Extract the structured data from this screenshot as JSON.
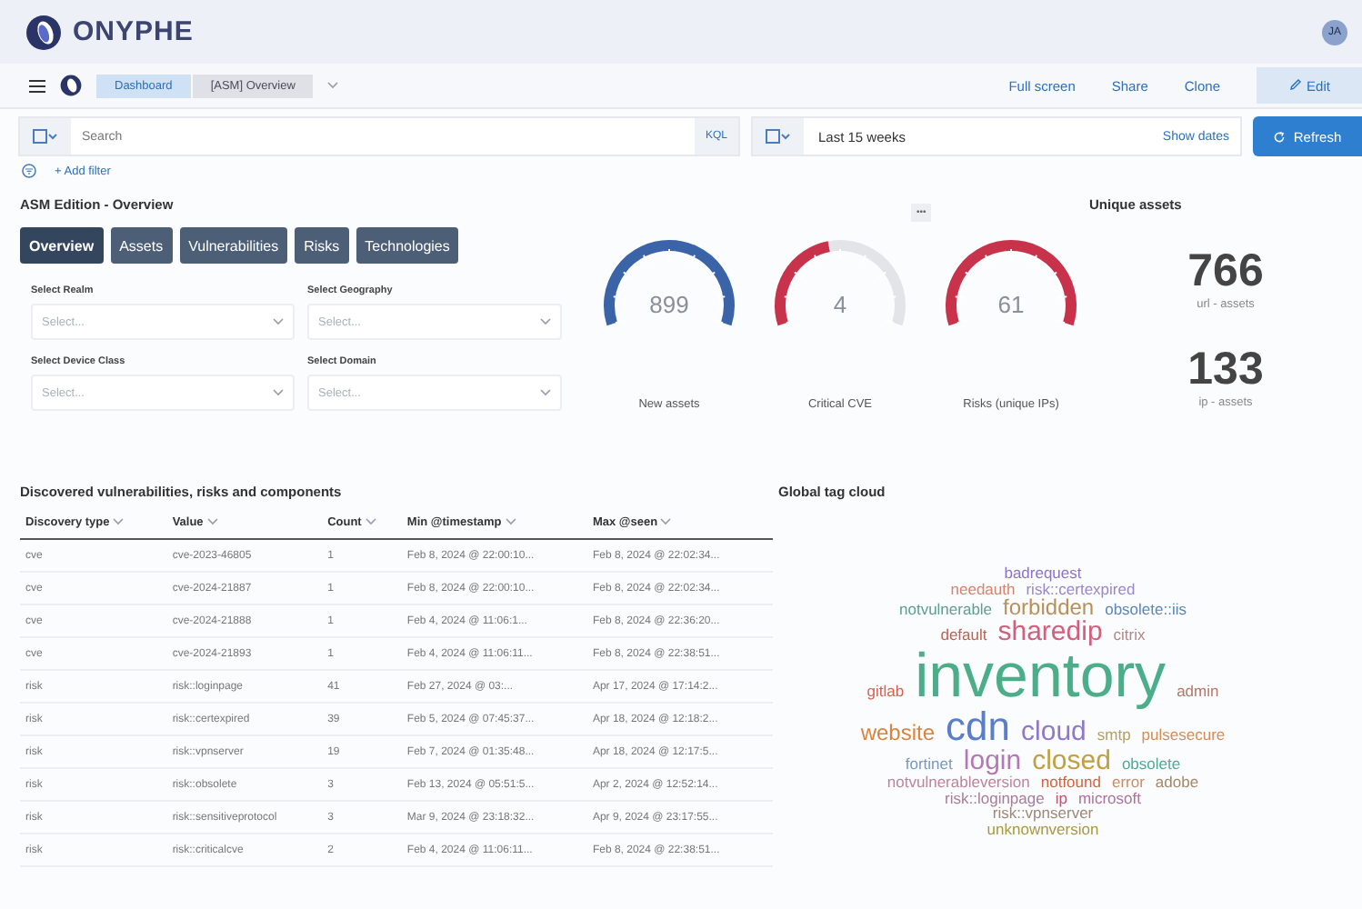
{
  "header": {
    "brand": "ONYPHE",
    "avatar": "JA"
  },
  "nav": {
    "breadcrumbs": [
      {
        "label": "Dashboard",
        "selected": false
      },
      {
        "label": "[ASM] Overview",
        "selected": true
      }
    ],
    "links": [
      "Full screen",
      "Share",
      "Clone"
    ],
    "edit": "Edit"
  },
  "query": {
    "placeholder": "Search",
    "language": "KQL",
    "time_range": "Last 15 weeks",
    "show_dates": "Show dates",
    "refresh": "Refresh",
    "add_filter": "+ Add filter"
  },
  "overview": {
    "title": "ASM Edition - Overview",
    "tabs": [
      {
        "label": "Overview",
        "selected": true
      },
      {
        "label": "Assets",
        "selected": false
      },
      {
        "label": "Vulnerabilities",
        "selected": false
      },
      {
        "label": "Risks",
        "selected": false
      },
      {
        "label": "Technologies",
        "selected": false
      }
    ],
    "selects": [
      {
        "label": "Select Realm",
        "placeholder": "Select..."
      },
      {
        "label": "Select Geography",
        "placeholder": "Select..."
      },
      {
        "label": "Select Device Class",
        "placeholder": "Select..."
      },
      {
        "label": "Select Domain",
        "placeholder": "Select..."
      }
    ]
  },
  "gauges": [
    {
      "value": "899",
      "label": "New assets",
      "level": 1,
      "color": "#3b64a8"
    },
    {
      "value": "4",
      "label": "Critical CVE",
      "level": 0.45,
      "color": "#c8324b"
    },
    {
      "value": "61",
      "label": "Risks (unique IPs)",
      "level": 1,
      "color": "#c8324b"
    }
  ],
  "more": "•••",
  "unique_assets": {
    "title": "Unique assets",
    "metrics": [
      {
        "value": "766",
        "label": "url - assets"
      },
      {
        "value": "133",
        "label": "ip - assets"
      }
    ]
  },
  "table": {
    "title": "Discovered vulnerabilities, risks and components",
    "columns": [
      "Discovery type",
      "Value",
      "Count",
      "Min @timestamp",
      "Max @seen"
    ],
    "rows": [
      [
        "cve",
        "cve-2023-46805",
        "1",
        "Feb 8, 2024 @ 22:00:10...",
        "Feb 8, 2024 @ 22:02:34..."
      ],
      [
        "cve",
        "cve-2024-21887",
        "1",
        "Feb 8, 2024 @ 22:00:10...",
        "Feb 8, 2024 @ 22:02:34..."
      ],
      [
        "cve",
        "cve-2024-21888",
        "1",
        "Feb 4, 2024 @ 11:06:1...",
        "Feb 8, 2024 @ 22:36:20..."
      ],
      [
        "cve",
        "cve-2024-21893",
        "1",
        "Feb 4, 2024 @ 11:06:11...",
        "Feb 8, 2024 @ 22:38:51..."
      ],
      [
        "risk",
        "risk::loginpage",
        "41",
        "Feb 27, 2024 @ 03:...",
        "Apr 17, 2024 @ 17:14:2..."
      ],
      [
        "risk",
        "risk::certexpired",
        "39",
        "Feb 5, 2024 @ 07:45:37...",
        "Apr 18, 2024 @ 12:18:2..."
      ],
      [
        "risk",
        "risk::vpnserver",
        "19",
        "Feb 7, 2024 @ 01:35:48...",
        "Apr 18, 2024 @ 12:17:5..."
      ],
      [
        "risk",
        "risk::obsolete",
        "3",
        "Feb 13, 2024 @ 05:51:5...",
        "Apr 2, 2024 @ 12:52:14..."
      ],
      [
        "risk",
        "risk::sensitiveprotocol",
        "3",
        "Mar 9, 2024 @ 23:18:32...",
        "Apr 9, 2024 @ 23:17:55..."
      ],
      [
        "risk",
        "risk::criticalcve",
        "2",
        "Feb 4, 2024 @ 11:06:11...",
        "Feb 8, 2024 @ 22:38:51..."
      ]
    ]
  },
  "tag_cloud": {
    "title": "Global tag cloud",
    "lines": [
      [
        {
          "text": "badrequest",
          "color": "#8c72cc",
          "kind": "small"
        }
      ],
      [
        {
          "text": "needauth",
          "color": "#d8826e",
          "kind": "small"
        },
        {
          "text": "risk::certexpired",
          "color": "#9a86c8",
          "kind": "small"
        }
      ],
      [
        {
          "text": "notvulnerable",
          "color": "#5e9e8e",
          "kind": "small"
        },
        {
          "text": "forbidden",
          "color": "#b8905a",
          "kind": "medium"
        },
        {
          "text": "obsolete::iis",
          "color": "#5a84c0",
          "kind": "small"
        }
      ],
      [
        {
          "text": "default",
          "color": "#c0604e",
          "kind": "small"
        },
        {
          "text": "sharedip",
          "color": "#d0607e",
          "kind": "large"
        },
        {
          "text": "citrix",
          "color": "#b08888",
          "kind": "small"
        }
      ],
      [
        {
          "text": "gitlab",
          "color": "#dc5e50",
          "kind": "small"
        },
        {
          "text": "inventory",
          "color": "#4cae88",
          "kind": "huge"
        },
        {
          "text": "admin",
          "color": "#b87464",
          "kind": "small"
        }
      ],
      [
        {
          "text": "website",
          "color": "#d8843c",
          "kind": "medium"
        },
        {
          "text": "cdn",
          "color": "#5a7ec8",
          "kind": "xlarge"
        },
        {
          "text": "cloud",
          "color": "#9078c8",
          "kind": "large"
        },
        {
          "text": "smtp",
          "color": "#b4a060",
          "kind": "small"
        },
        {
          "text": "pulsesecure",
          "color": "#d88c50",
          "kind": "small"
        }
      ],
      [
        {
          "text": "fortinet",
          "color": "#7898c4",
          "kind": "small"
        },
        {
          "text": "login",
          "color": "#b478b4",
          "kind": "large"
        },
        {
          "text": "closed",
          "color": "#c0a040",
          "kind": "large"
        },
        {
          "text": "obsolete",
          "color": "#4ea898",
          "kind": "small"
        }
      ],
      [
        {
          "text": "notvulnerableversion",
          "color": "#c08498",
          "kind": "small"
        },
        {
          "text": "notfound",
          "color": "#d8603c",
          "kind": "small"
        },
        {
          "text": "error",
          "color": "#cc8c64",
          "kind": "small"
        },
        {
          "text": "adobe",
          "color": "#a48866",
          "kind": "small"
        }
      ],
      [
        {
          "text": "risk::loginpage",
          "color": "#a87c98",
          "kind": "small"
        },
        {
          "text": "ip",
          "color": "#c45070",
          "kind": "small"
        },
        {
          "text": "microsoft",
          "color": "#b070a0",
          "kind": "small"
        }
      ],
      [
        {
          "text": "risk::vpnserver",
          "color": "#a08878",
          "kind": "small"
        }
      ],
      [
        {
          "text": "unknownversion",
          "color": "#a89840",
          "kind": "small"
        }
      ]
    ]
  }
}
